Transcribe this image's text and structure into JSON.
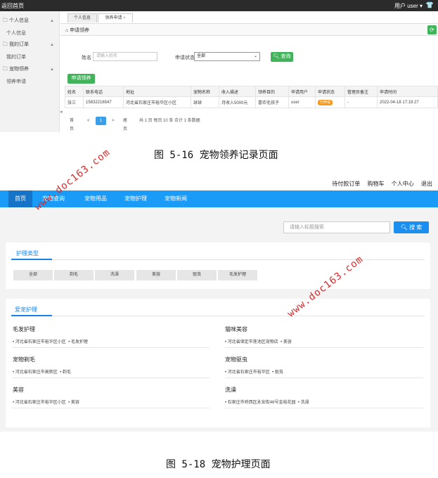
{
  "admin": {
    "topbar": {
      "home": "返回首页",
      "user": "用户  user ▾",
      "icon": "shirt-icon"
    },
    "sidebar": {
      "groups": [
        {
          "label": "个人信息",
          "items": [
            "个人信息"
          ]
        },
        {
          "label": "我的订单",
          "items": [
            "我的订单"
          ]
        },
        {
          "label": "宠物领养",
          "items": [
            "领养申请"
          ]
        }
      ]
    },
    "tabs": [
      "个人信息",
      "领养申请"
    ],
    "tab_close": "×",
    "breadcrumb": "申请领养",
    "filter": {
      "name_label": "姓名",
      "name_placeholder": "请输入姓名",
      "status_label": "申请状态",
      "status_value": "全部",
      "query_button": "查询"
    },
    "apply_button": "申请领养",
    "table": {
      "headers": [
        "姓名",
        "联系电话",
        "地址",
        "宠物名称",
        "收入描述",
        "领养目的",
        "申请用户",
        "申请状态",
        "管理员备注",
        "申请时间"
      ],
      "rows": [
        [
          "张三",
          "15832216547",
          "河北省石家庄市裕华区小区",
          "球球",
          "月收入5000元",
          "喜欢毛孩子",
          "user",
          "已申请",
          "-",
          "2022-04-18 17:19:27"
        ]
      ]
    },
    "pager": {
      "first": "首页",
      "prev": "<",
      "current": "1",
      "next": ">",
      "last": "尾页",
      "summary": "共 1 页   每页 10 条   合计 1 条数据"
    }
  },
  "caption1": "图 5-16  宠物领养记录页面",
  "front": {
    "top_links": [
      "待付款订单",
      "购物车",
      "个人中心",
      "退出"
    ],
    "nav": [
      "首页",
      "宠物查询",
      "宠物用品",
      "宠物护理",
      "宠物新闻"
    ],
    "search": {
      "placeholder": "请输入标题搜索",
      "button": "搜 索"
    },
    "care_types": {
      "title": "护理类型",
      "items": [
        "全部",
        "剃毛",
        "洗澡",
        "美容",
        "驱虫",
        "毛发护理"
      ]
    },
    "care_list": {
      "title": "爱宠护理",
      "items": [
        {
          "title": "毛发护理",
          "address": "河北省石家庄市裕华区小区",
          "tag": "毛发护理"
        },
        {
          "title": "猫咪美容",
          "address": "河北省保定市莲池区宠物店",
          "tag": "美容"
        },
        {
          "title": "宠物剃毛",
          "address": "河北省石家庄市高新区",
          "tag": "剃毛"
        },
        {
          "title": "宠物驱虫",
          "address": "河北省石家庄市裕华区",
          "tag": "驱虫"
        },
        {
          "title": "美容",
          "address": "河北省石家庄市裕华区小区",
          "tag": "美容"
        },
        {
          "title": "洗澡",
          "address": "石家庄市桥西区永安街46号金裕花园",
          "tag": "洗澡"
        }
      ]
    }
  },
  "caption2": "图 5-18  宠物护理页面",
  "watermarks": [
    "www.doc163.com",
    "www.doc163.com"
  ],
  "colors": {
    "accent": "#1a9bf7",
    "green": "#41b35a",
    "watermark": "#d92b2b",
    "badge": "#f59a1f"
  }
}
